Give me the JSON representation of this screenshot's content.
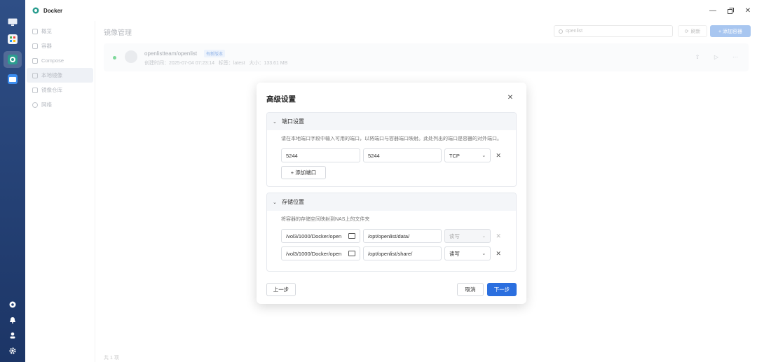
{
  "window": {
    "title": "Docker"
  },
  "sidebar": {
    "items": [
      {
        "label": "概览"
      },
      {
        "label": "容器"
      },
      {
        "label": "Compose"
      },
      {
        "label": "本地镜像"
      },
      {
        "label": "镜像仓库"
      },
      {
        "label": "网络"
      }
    ]
  },
  "main": {
    "title": "镜像管理",
    "search_placeholder": "openlist",
    "refresh_label": "刷新",
    "add_container_label": "+ 添加容器",
    "footer_count": "共 1 项"
  },
  "image": {
    "name": "openlistteam/openlist",
    "tag_badge": "有新版本",
    "created_label": "创建时间：",
    "created_value": "2025-07-04 07:23:14",
    "tag_label": "标签：",
    "tag_value": "latest",
    "size_label": "大小：",
    "size_value": "133.61 MB"
  },
  "modal": {
    "title": "高级设置",
    "port_section": {
      "title": "端口设置",
      "hint": "请在本地端口字段中输入可用的端口，以将端口与容器端口映射。此处列出的端口是容器的对外端口。",
      "rows": [
        {
          "local_port": "5244",
          "container_port": "5244",
          "protocol": "TCP"
        }
      ],
      "add_label": "+ 添加端口"
    },
    "storage_section": {
      "title": "存储位置",
      "hint": "将容器的存储空间映射到NAS上的文件夹",
      "rows": [
        {
          "host_path": "/vol3/1000/Docker/open",
          "container_path": "/opt/openlist/data/",
          "mode": "读写",
          "disabled": true
        },
        {
          "host_path": "/vol3/1000/Docker/open",
          "container_path": "/opt/openlist/share/",
          "mode": "读写",
          "disabled": false
        }
      ]
    },
    "prev_label": "上一步",
    "cancel_label": "取消",
    "next_label": "下一步"
  },
  "colors": {
    "accent": "#2b6fdf",
    "dock": "#1c3566"
  },
  "icons": [
    "desktop-icon",
    "app-center-icon",
    "docker-icon",
    "files-icon",
    "settings-icon",
    "bell-icon",
    "user-icon",
    "gear-icon"
  ]
}
